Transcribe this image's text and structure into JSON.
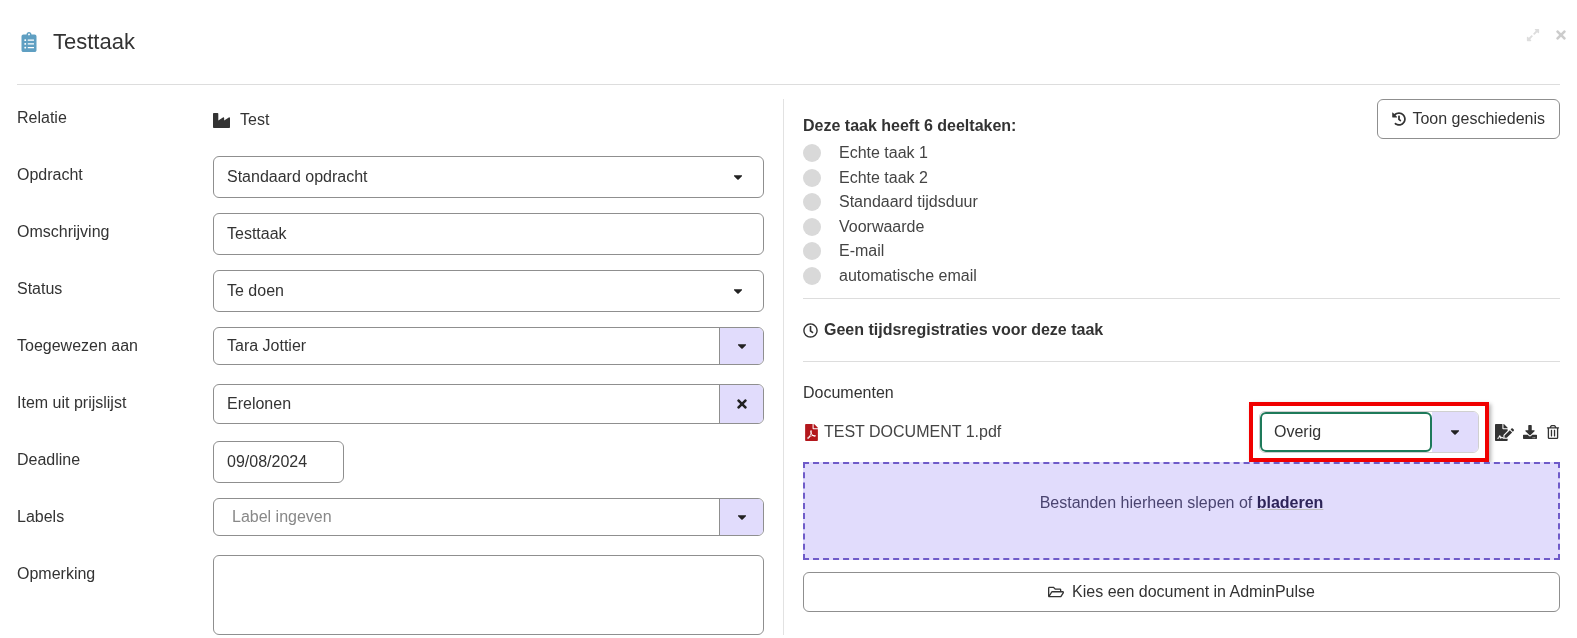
{
  "header": {
    "title": "Testtaak"
  },
  "fields": [
    {
      "label": "Relatie",
      "kind": "text",
      "value": "Test"
    },
    {
      "label": "Opdracht",
      "kind": "select",
      "value": "Standaard opdracht"
    },
    {
      "label": "Omschrijving",
      "kind": "input",
      "value": "Testtaak"
    },
    {
      "label": "Status",
      "kind": "select",
      "value": "Te doen"
    },
    {
      "label": "Toegewezen aan",
      "kind": "dropdown",
      "value": "Tara Jottier"
    },
    {
      "label": "Item uit prijslijst",
      "kind": "clearable",
      "value": "Erelonen"
    },
    {
      "label": "Deadline",
      "kind": "date",
      "value": "09/08/2024"
    },
    {
      "label": "Labels",
      "kind": "dropdown",
      "placeholder": "Label ingeven"
    },
    {
      "label": "Opmerking",
      "kind": "textarea"
    }
  ],
  "history_button": "Toon geschiedenis",
  "subtasks": {
    "heading": "Deze taak heeft 6 deeltaken:",
    "items": [
      {
        "label": "Echte taak 1",
        "done": false
      },
      {
        "label": "Echte taak 2",
        "done": false
      },
      {
        "label": "Standaard tijdsduur",
        "done": false
      },
      {
        "label": "Voorwaarde",
        "done": false
      },
      {
        "label": "E-mail",
        "done": false
      },
      {
        "label": "automatische email",
        "done": false
      }
    ]
  },
  "time_registrations": "Geen tijdsregistraties voor deze taak",
  "documents": {
    "heading": "Documenten",
    "files": [
      {
        "name": "TEST DOCUMENT 1.pdf",
        "type": "Overig",
        "highlighted": true
      }
    ],
    "dropzone": "Bestanden hierheen slepen of **bladeren**",
    "choose_button": "Kies een document in AdminPulse"
  }
}
